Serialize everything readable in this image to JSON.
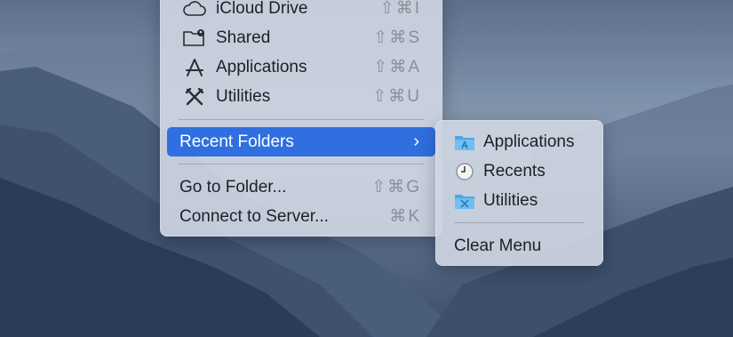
{
  "menu": {
    "items": [
      {
        "label": "iCloud Drive",
        "shortcut": "⇧⌘I",
        "icon": "cloud-icon"
      },
      {
        "label": "Shared",
        "shortcut": "⇧⌘S",
        "icon": "shared-folder-icon"
      },
      {
        "label": "Applications",
        "shortcut": "⇧⌘A",
        "icon": "applications-icon"
      },
      {
        "label": "Utilities",
        "shortcut": "⇧⌘U",
        "icon": "utilities-icon"
      },
      {
        "label": "Recent Folders",
        "chevron": "›"
      },
      {
        "label": "Go to Folder...",
        "shortcut": "⇧⌘G"
      },
      {
        "label": "Connect to Server...",
        "shortcut": "⌘K"
      }
    ]
  },
  "submenu": {
    "items": [
      {
        "label": "Applications",
        "icon": "folder-applications-icon"
      },
      {
        "label": "Recents",
        "icon": "clock-icon"
      },
      {
        "label": "Utilities",
        "icon": "folder-utilities-icon"
      },
      {
        "label": "Clear Menu"
      }
    ]
  },
  "colors": {
    "highlight": "#2f6fe0",
    "folder": "#4aa8e8"
  }
}
